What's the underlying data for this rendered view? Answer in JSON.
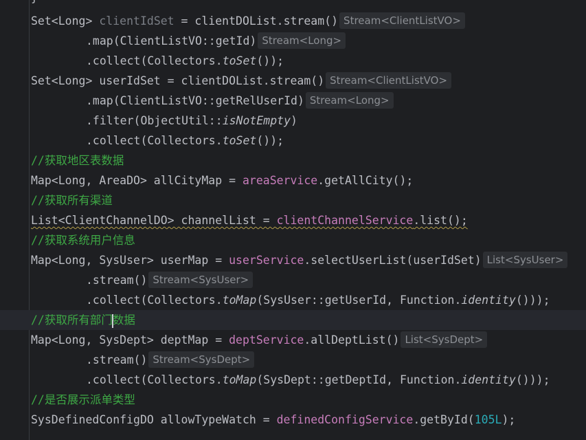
{
  "code": {
    "top_fragment": "}",
    "lines": [
      {
        "segments": [
          {
            "t": "Set<Long> "
          },
          {
            "t": "clientIdSet",
            "cls": "c-unused"
          },
          {
            "t": " = clientDOList.stream()"
          }
        ],
        "hint": "Stream<ClientListVO>"
      },
      {
        "segments": [
          {
            "t": ".map(ClientListVO::getId)"
          }
        ],
        "hint": "Stream<Long>"
      },
      {
        "segments": [
          {
            "t": ".collect(Collectors."
          },
          {
            "t": "toSet",
            "cls": "c-italic"
          },
          {
            "t": "());"
          }
        ]
      },
      {
        "segments": [
          {
            "t": "Set<Long> userIdSet = clientDOList.stream()"
          }
        ],
        "hint": "Stream<ClientListVO>"
      },
      {
        "segments": [
          {
            "t": ".map(ClientListVO::getRelUserId)"
          }
        ],
        "hint": "Stream<Long>"
      },
      {
        "segments": [
          {
            "t": ".filter(ObjectUtil::"
          },
          {
            "t": "isNotEmpty",
            "cls": "c-italic"
          },
          {
            "t": ")"
          }
        ]
      },
      {
        "segments": [
          {
            "t": ".collect(Collectors."
          },
          {
            "t": "toSet",
            "cls": "c-italic"
          },
          {
            "t": "());"
          }
        ]
      },
      {
        "segments": [
          {
            "t": "//获取地区表数据",
            "cls": "c-comment"
          }
        ]
      },
      {
        "segments": [
          {
            "t": "Map<Long, AreaDO> allCityMap = "
          },
          {
            "t": "areaService",
            "cls": "c-field"
          },
          {
            "t": ".getAllCity();"
          }
        ]
      },
      {
        "segments": [
          {
            "t": "//获取所有渠道",
            "cls": "c-comment"
          }
        ]
      },
      {
        "segments": [
          {
            "t": "List<ClientChannelDO> channelList = ",
            "cls": "squiggle"
          },
          {
            "t": "clientChannelService",
            "cls": "c-field squiggle"
          },
          {
            "t": ".list();",
            "cls": "squiggle"
          }
        ]
      },
      {
        "segments": [
          {
            "t": "//获取系统用户信息",
            "cls": "c-comment"
          }
        ]
      },
      {
        "segments": [
          {
            "t": "Map<Long, SysUser> userMap = "
          },
          {
            "t": "userService",
            "cls": "c-field"
          },
          {
            "t": ".selectUserList(userIdSet)"
          }
        ],
        "hint": "List<SysUser>"
      },
      {
        "segments": [
          {
            "t": ".stream()"
          }
        ],
        "hint": "Stream<SysUser>"
      },
      {
        "segments": [
          {
            "t": ".collect(Collectors."
          },
          {
            "t": "toMap",
            "cls": "c-italic"
          },
          {
            "t": "(SysUser::getUserId, Function."
          },
          {
            "t": "identity",
            "cls": "c-italic"
          },
          {
            "t": "()));"
          }
        ]
      },
      {
        "segments": [
          {
            "t": "//获取所有部门",
            "cls": "c-comment"
          },
          {
            "caret": true
          },
          {
            "t": "数据",
            "cls": "c-comment"
          }
        ],
        "current": true
      },
      {
        "segments": [
          {
            "t": "Map<Long, SysDept> deptMap = "
          },
          {
            "t": "deptService",
            "cls": "c-field"
          },
          {
            "t": ".allDeptList()"
          }
        ],
        "hint": "List<SysDept>"
      },
      {
        "segments": [
          {
            "t": ".stream()"
          }
        ],
        "hint": "Stream<SysDept>"
      },
      {
        "segments": [
          {
            "t": ".collect(Collectors."
          },
          {
            "t": "toMap",
            "cls": "c-italic"
          },
          {
            "t": "(SysDept::getDeptId, Function."
          },
          {
            "t": "identity",
            "cls": "c-italic"
          },
          {
            "t": "()));"
          }
        ]
      },
      {
        "segments": [
          {
            "t": "//是否展示派单类型",
            "cls": "c-comment"
          }
        ]
      },
      {
        "segments": [
          {
            "t": "SysDefinedConfigDO allowTypeWatch = "
          },
          {
            "t": "definedConfigService",
            "cls": "c-field"
          },
          {
            "t": ".getById("
          },
          {
            "t": "105L",
            "cls": "c-number"
          },
          {
            "t": ");"
          }
        ]
      }
    ]
  },
  "theme": {
    "background": "#1e1f22",
    "text": "#bcbec4",
    "comment": "#3ea845",
    "field": "#c77dbb",
    "number": "#2aacb8",
    "hint_bg": "#2d2f33",
    "hint_text": "#8c8f94"
  }
}
